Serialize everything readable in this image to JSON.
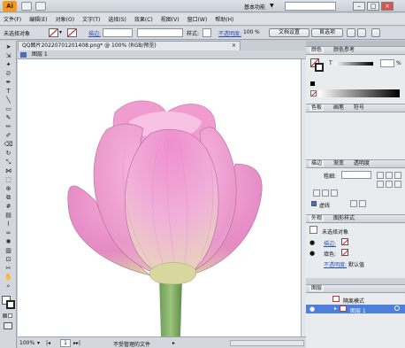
{
  "app": {
    "logo": "Ai",
    "workspace": "基本功能",
    "workspace_arrow": "▼",
    "window_buttons": [
      "–",
      "□",
      "×"
    ]
  },
  "menu": [
    "文件(F)",
    "编辑(E)",
    "对象(O)",
    "文字(T)",
    "选择(S)",
    "效果(C)",
    "视图(V)",
    "窗口(W)",
    "帮助(H)"
  ],
  "control": {
    "selection_label": "未选择对象",
    "stroke_label": "描边:",
    "style_label": "样式:",
    "opacity_label": "不透明度:",
    "opacity_value": "100",
    "opacity_unit": "%",
    "doc_settings": "文档设置",
    "preferences": "首选项"
  },
  "document": {
    "tab_title": "QQ图片20220701201408.png* @ 100% (RGB/预览)",
    "layer_label": "图层 1",
    "zoom": "100%",
    "page": "1",
    "status_text": "不受管理的文件"
  },
  "panels": {
    "color": {
      "tabs": [
        "颜色",
        "颜色参考"
      ],
      "k_label": "T",
      "k_value": "",
      "k_unit": "%"
    },
    "swatches": {
      "tabs": [
        "色板",
        "画笔",
        "符号"
      ]
    },
    "stroke": {
      "tabs": [
        "描边",
        "渐变",
        "透明度"
      ],
      "weight_label": "粗细:",
      "dashed_label": "虚线"
    },
    "appearance": {
      "tabs": [
        "外观",
        "图形样式"
      ],
      "title": "未选择对象",
      "stroke_label": "描边:",
      "fill_label": "填色:",
      "opacity_label": "不透明度:",
      "opacity_value": "默认值"
    },
    "layers": {
      "tab": "图层",
      "rows": [
        {
          "name": "隔离模式",
          "highlighted": false
        },
        {
          "name": "图层 1",
          "highlighted": true
        }
      ]
    }
  },
  "colors": {
    "accent_blue": "#3b6fd6",
    "selection_blue": "#4d7fdc",
    "panel_bg": "#cdd2d8",
    "flower_pink": "#e98ac6"
  }
}
